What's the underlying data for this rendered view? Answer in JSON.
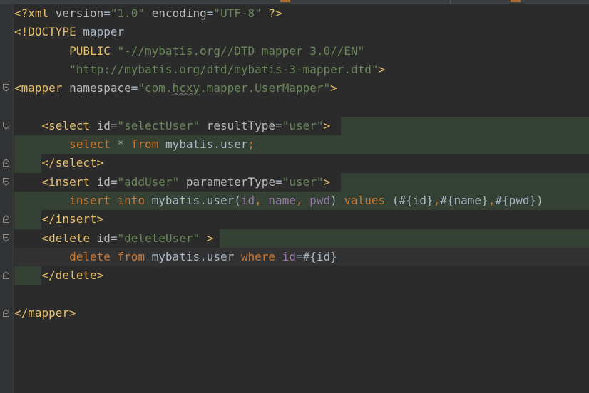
{
  "editor": {
    "lines": [
      {
        "tokens": [
          {
            "c": "t-tag",
            "t": "<?xml "
          },
          {
            "c": "t-attr",
            "t": "version"
          },
          {
            "c": "t-txt",
            "t": "="
          },
          {
            "c": "t-str",
            "t": "\"1.0\""
          },
          {
            "c": "t-txt",
            "t": " "
          },
          {
            "c": "t-attr",
            "t": "encoding"
          },
          {
            "c": "t-txt",
            "t": "="
          },
          {
            "c": "t-str",
            "t": "\"UTF-8\""
          },
          {
            "c": "t-txt",
            "t": " "
          },
          {
            "c": "t-tag",
            "t": "?>"
          }
        ]
      },
      {
        "tokens": [
          {
            "c": "t-tag",
            "t": "<!DOCTYPE "
          },
          {
            "c": "t-txt",
            "t": "mapper"
          }
        ]
      },
      {
        "tokens": [
          {
            "c": "t-txt",
            "t": "        "
          },
          {
            "c": "t-tag",
            "t": "PUBLIC "
          },
          {
            "c": "t-str",
            "t": "\"-//mybatis.org//DTD mapper 3.0//EN\""
          }
        ]
      },
      {
        "tokens": [
          {
            "c": "t-txt",
            "t": "        "
          },
          {
            "c": "t-str",
            "t": "\"http://mybatis.org/dtd/mybatis-3-mapper.dtd\""
          },
          {
            "c": "t-tag",
            "t": ">"
          }
        ]
      },
      {
        "fold": "open",
        "tokens": [
          {
            "c": "t-tag",
            "t": "<mapper "
          },
          {
            "c": "t-attr",
            "t": "namespace"
          },
          {
            "c": "t-txt",
            "t": "="
          },
          {
            "c": "t-str",
            "t": "\"com."
          },
          {
            "c": "t-str wavy",
            "t": "hcxy"
          },
          {
            "c": "t-str",
            "t": ".mapper.UserMapper\""
          },
          {
            "c": "t-tag",
            "t": ">"
          }
        ]
      },
      {
        "tokens": []
      },
      {
        "fold": "open",
        "hl": {
          "from": 478,
          "to": 826
        },
        "tokens": [
          {
            "c": "t-txt",
            "t": "    "
          },
          {
            "c": "t-tag",
            "t": "<select "
          },
          {
            "c": "t-attr",
            "t": "id"
          },
          {
            "c": "t-txt",
            "t": "="
          },
          {
            "c": "t-str",
            "t": "\"selectUser\""
          },
          {
            "c": "t-txt",
            "t": " "
          },
          {
            "c": "t-attr",
            "t": "resultType"
          },
          {
            "c": "t-txt",
            "t": "="
          },
          {
            "c": "t-str",
            "t": "\"user\""
          },
          {
            "c": "t-tag",
            "t": ">"
          }
        ]
      },
      {
        "hl": {
          "from": 20,
          "to": 826
        },
        "tokens": [
          {
            "c": "t-txt",
            "t": "        "
          },
          {
            "c": "t-kw",
            "t": "select "
          },
          {
            "c": "t-txt",
            "t": "* "
          },
          {
            "c": "t-kw",
            "t": "from "
          },
          {
            "c": "t-txt",
            "t": "mybatis.user"
          },
          {
            "c": "t-kw",
            "t": ";"
          }
        ]
      },
      {
        "fold": "close",
        "hl": {
          "from": 20,
          "to": 58
        },
        "tokens": [
          {
            "c": "t-txt",
            "t": "    "
          },
          {
            "c": "t-tag",
            "t": "</select>"
          }
        ]
      },
      {
        "fold": "open",
        "hl": {
          "from": 478,
          "to": 826
        },
        "tokens": [
          {
            "c": "t-txt",
            "t": "    "
          },
          {
            "c": "t-tag",
            "t": "<insert "
          },
          {
            "c": "t-attr",
            "t": "id"
          },
          {
            "c": "t-txt",
            "t": "="
          },
          {
            "c": "t-str",
            "t": "\"addUser\""
          },
          {
            "c": "t-txt",
            "t": " "
          },
          {
            "c": "t-attr",
            "t": "parameterType"
          },
          {
            "c": "t-txt",
            "t": "="
          },
          {
            "c": "t-str",
            "t": "\"user\""
          },
          {
            "c": "t-tag",
            "t": ">"
          }
        ]
      },
      {
        "hl": {
          "from": 20,
          "to": 826
        },
        "tokens": [
          {
            "c": "t-txt",
            "t": "        "
          },
          {
            "c": "t-kw",
            "t": "insert into "
          },
          {
            "c": "t-txt",
            "t": "mybatis.user("
          },
          {
            "c": "t-col",
            "t": "id"
          },
          {
            "c": "t-kw",
            "t": ", "
          },
          {
            "c": "t-col",
            "t": "name"
          },
          {
            "c": "t-kw",
            "t": ", "
          },
          {
            "c": "t-col",
            "t": "pwd"
          },
          {
            "c": "t-txt",
            "t": ") "
          },
          {
            "c": "t-kw",
            "t": "values "
          },
          {
            "c": "t-txt",
            "t": "(#{id}"
          },
          {
            "c": "t-kw",
            "t": ","
          },
          {
            "c": "t-txt",
            "t": "#{name}"
          },
          {
            "c": "t-kw",
            "t": ","
          },
          {
            "c": "t-txt",
            "t": "#{pwd})"
          }
        ]
      },
      {
        "fold": "close",
        "hl": {
          "from": 20,
          "to": 58
        },
        "tokens": [
          {
            "c": "t-txt",
            "t": "    "
          },
          {
            "c": "t-tag",
            "t": "</insert>"
          }
        ]
      },
      {
        "fold": "open",
        "hl": {
          "from": 308,
          "to": 826
        },
        "tokens": [
          {
            "c": "t-txt",
            "t": "    "
          },
          {
            "c": "t-tag",
            "t": "<delete "
          },
          {
            "c": "t-attr",
            "t": "id"
          },
          {
            "c": "t-txt",
            "t": "="
          },
          {
            "c": "t-str",
            "t": "\"deleteUser\""
          },
          {
            "c": "t-txt",
            "t": " "
          },
          {
            "c": "t-tag",
            "t": ">"
          }
        ]
      },
      {
        "hl": {
          "from": 20,
          "to": 826,
          "dim": true
        },
        "tokens": [
          {
            "c": "t-txt",
            "t": "        "
          },
          {
            "c": "t-kw",
            "t": "delete from "
          },
          {
            "c": "t-txt",
            "t": "mybatis.user "
          },
          {
            "c": "t-kw",
            "t": "where "
          },
          {
            "c": "t-col",
            "t": "id"
          },
          {
            "c": "t-txt",
            "t": "=#{id}"
          }
        ]
      },
      {
        "fold": "close",
        "hl": {
          "from": 20,
          "to": 58
        },
        "tokens": [
          {
            "c": "t-txt",
            "t": "    "
          },
          {
            "c": "t-tag",
            "t": "</delete>"
          }
        ]
      },
      {
        "tokens": []
      },
      {
        "fold": "close",
        "tokens": [
          {
            "c": "t-tag",
            "t": "</mapper>"
          }
        ]
      }
    ]
  },
  "colors": {
    "background": "#2b2b2b",
    "gutter": "#313335",
    "tag": "#e8bf6a",
    "attribute": "#bababa",
    "string": "#6a8759",
    "keyword": "#cc7832",
    "text": "#a9b7c6",
    "column": "#9876aa",
    "highlight": "#344134"
  }
}
